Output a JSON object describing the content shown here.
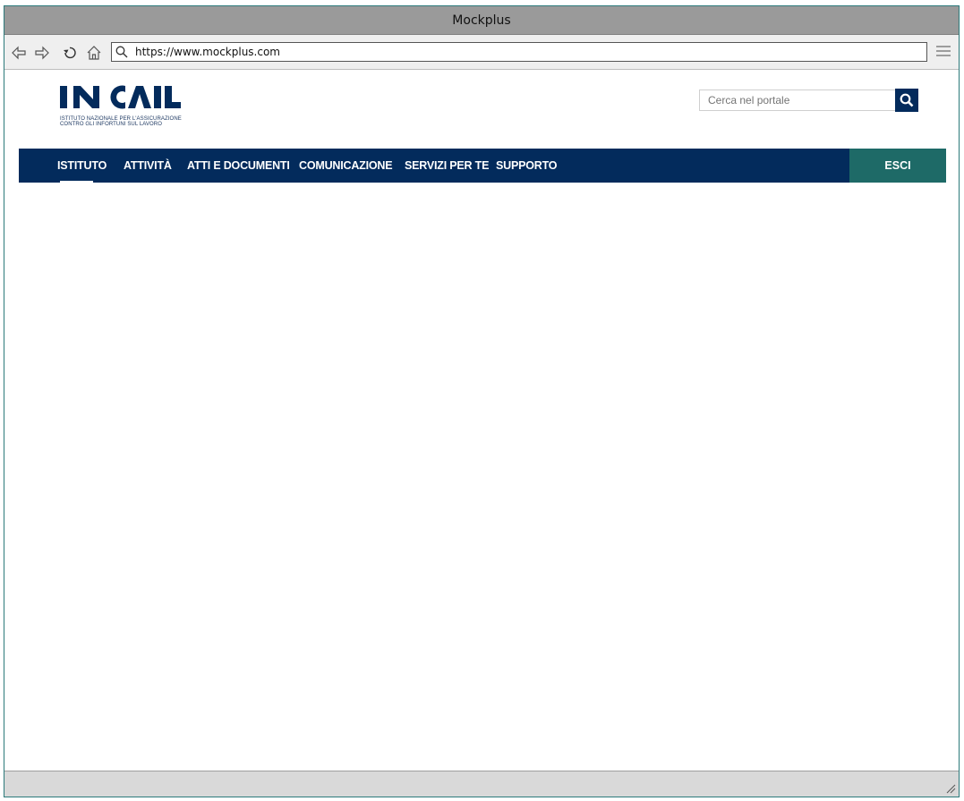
{
  "window": {
    "title": "Mockplus"
  },
  "browser": {
    "url": "https://www.mockplus.com",
    "icons": [
      "back-icon",
      "forward-icon",
      "refresh-icon",
      "home-icon",
      "search-icon",
      "menu-icon"
    ]
  },
  "site": {
    "logo_text": "INAIL",
    "logo_subtitle_line1": "ISTITUTO NAZIONALE PER L'ASSICURAZIONE",
    "logo_subtitle_line2": "CONTRO GLI INFORTUNI SUL LAVORO",
    "search_placeholder": "Cerca nel portale",
    "nav": {
      "items": [
        {
          "label": "ISTITUTO"
        },
        {
          "label": "ATTIVITÀ"
        },
        {
          "label": "ATTI E DOCUMENTI"
        },
        {
          "label": "COMUNICAZIONE"
        },
        {
          "label": "SERVIZI PER TE"
        },
        {
          "label": "SUPPORTO"
        }
      ],
      "active_index": 0,
      "exit_label": "ESCI"
    },
    "colors": {
      "nav_bg": "#032b5c",
      "exit_bg": "#1e6a67",
      "logo": "#032b5c"
    }
  }
}
